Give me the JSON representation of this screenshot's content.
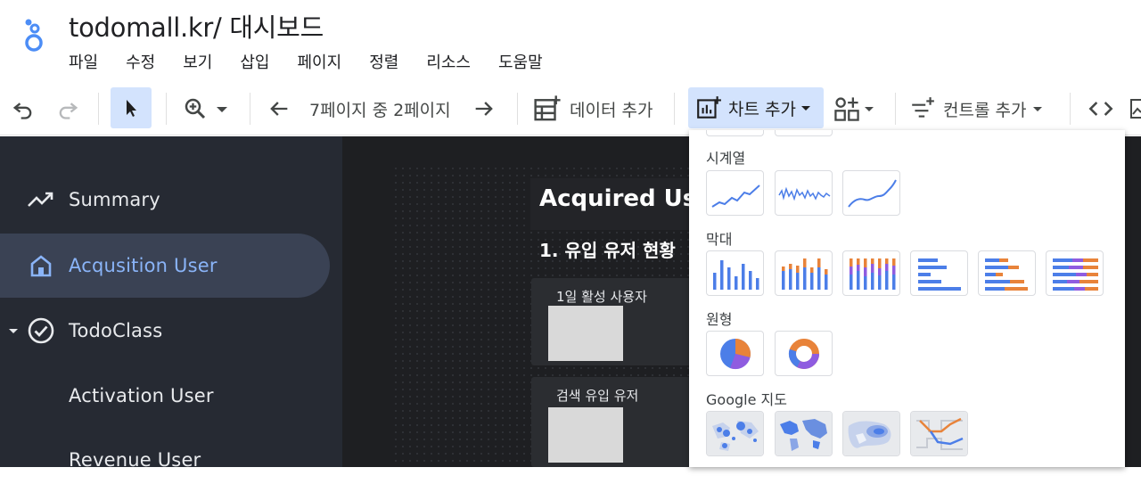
{
  "header": {
    "title": "todomall.kr/ 대시보드",
    "menu": [
      "파일",
      "수정",
      "보기",
      "삽입",
      "페이지",
      "정렬",
      "리소스",
      "도움말"
    ]
  },
  "toolbar": {
    "page_indicator": "7페이지 중 2페이지",
    "add_data_label": "데이터 추가",
    "add_chart_label": "차트 추가",
    "add_control_label": "컨트롤 추가"
  },
  "sidebar": {
    "items": [
      {
        "label": "Summary",
        "icon": "trending-up-icon"
      },
      {
        "label": "Acqusition User",
        "icon": "home-icon",
        "active": true
      },
      {
        "label": "TodoClass",
        "icon": "check-circle-icon"
      },
      {
        "label": "Activation User"
      },
      {
        "label": "Revenue User"
      }
    ]
  },
  "report": {
    "heading": "Acquired Use",
    "subheading": "1. 유입 유저 현황",
    "cards": [
      "1일 활성 사용자",
      "검색 유입 유저"
    ]
  },
  "chart_menu": {
    "sections": [
      "시계열",
      "막대",
      "원형",
      "Google 지도"
    ]
  },
  "colors": {
    "accent_blue": "#4c7ee8",
    "accent_orange": "#e8833a",
    "accent_purple": "#8f5ce0",
    "selected_bg": "#d3e3fd",
    "sidebar_bg": "#262a33",
    "sidebar_active": "#3a4254",
    "sidebar_active_text": "#8ab4f8"
  }
}
